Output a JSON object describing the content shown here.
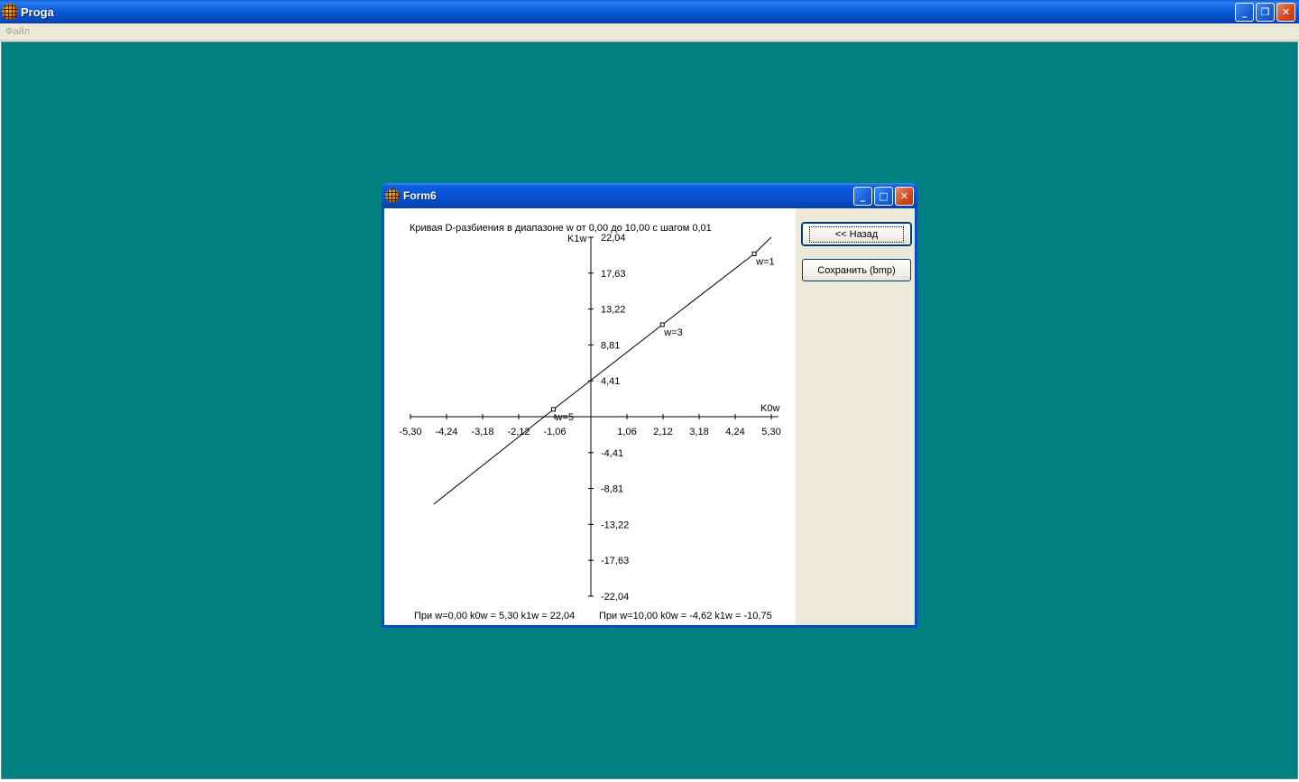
{
  "app": {
    "title": "Proga",
    "menu": [
      "Файл"
    ],
    "window_buttons": {
      "minimize": "_",
      "restore": "❐",
      "close": "✕"
    }
  },
  "form": {
    "title": "Form6",
    "window_buttons": {
      "minimize": "_",
      "maximize": "□",
      "close": "✕"
    },
    "back_button": "<< Назад",
    "save_button": "Сохранить (bmp)",
    "workspace_color": "#008080"
  },
  "chart_data": {
    "type": "line",
    "title": "Кривая D-разбиения в диапазоне w от 0,00 до 10,00 с шагом 0,01",
    "xlabel": "K0w",
    "ylabel": "K1w",
    "xlim": [
      -5.3,
      5.3
    ],
    "ylim": [
      -22.04,
      22.04
    ],
    "x_ticks": [
      "-5,30",
      "-4,24",
      "-3,18",
      "-2,12",
      "-1,06",
      "1,06",
      "2,12",
      "3,18",
      "4,24",
      "5,30"
    ],
    "x_tick_values": [
      -5.3,
      -4.24,
      -3.18,
      -2.12,
      -1.06,
      1.06,
      2.12,
      3.18,
      4.24,
      5.3
    ],
    "y_ticks": [
      "22,04",
      "17,63",
      "13,22",
      "8,81",
      "4,41",
      "-4,41",
      "-8,81",
      "-13,22",
      "-17,63",
      "-22,04"
    ],
    "y_tick_values": [
      22.04,
      17.63,
      13.22,
      8.81,
      4.41,
      -4.41,
      -8.81,
      -13.22,
      -17.63,
      -22.04
    ],
    "series": [
      {
        "x": [
          5.3,
          4.8,
          2.1,
          -1.1,
          -4.62
        ],
        "y": [
          22.04,
          20.0,
          11.3,
          0.9,
          -10.75
        ]
      }
    ],
    "annotations": [
      {
        "text": "w=1",
        "x": 4.8,
        "y": 20.0
      },
      {
        "text": "w=3",
        "x": 2.1,
        "y": 11.3
      },
      {
        "text": "w=5",
        "x": -1.1,
        "y": 0.9
      }
    ],
    "footer_left": "При w=0,00 k0w = 5,30 k1w = 22,04",
    "footer_right": "При w=10,00 k0w = -4,62 k1w = -10,75",
    "grid": false
  }
}
